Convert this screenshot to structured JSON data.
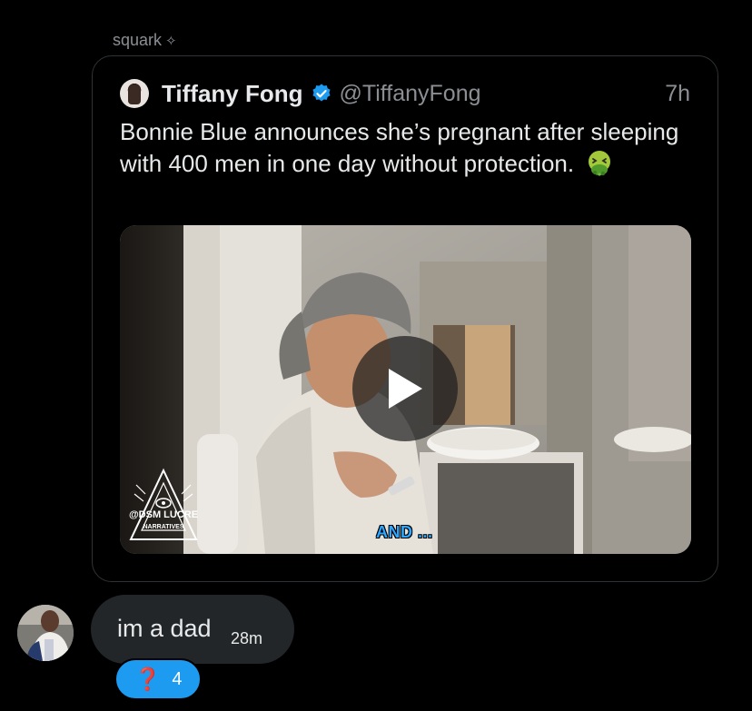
{
  "sender": {
    "name": "squark",
    "status_icon": "sparkle-icon"
  },
  "quoted_tweet": {
    "display_name": "Tiffany Fong",
    "verified": true,
    "handle": "@TiffanyFong",
    "time": "7h",
    "text": "Bonnie Blue announces she’s pregnant after sleeping with 400 men in one day without protection.",
    "emoji": "nauseated-face-emoji",
    "media": {
      "type": "video",
      "watermark_line1": "@DSM LUCRE",
      "watermark_line2": "NARRATIVES",
      "caption": "AND ..."
    }
  },
  "reply": {
    "text": "im a dad",
    "time": "28m",
    "reaction": {
      "emoji": "❓",
      "count": "4"
    }
  },
  "colors": {
    "background": "#000000",
    "bubble": "#232628",
    "reaction": "#1d9bf0",
    "verified": "#1d9bf0",
    "muted_text": "#8b8f94"
  }
}
